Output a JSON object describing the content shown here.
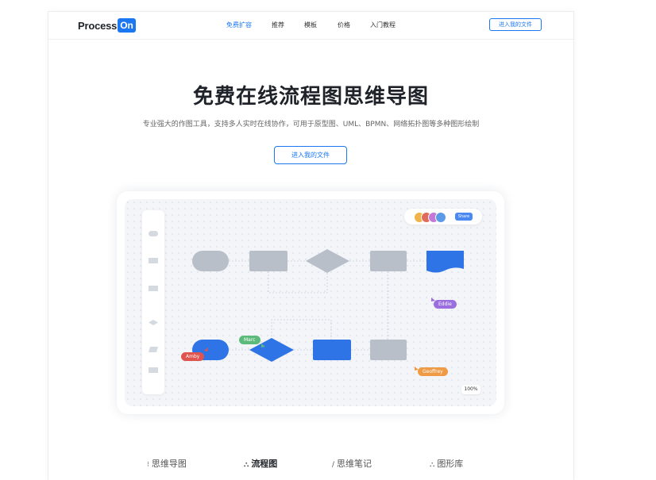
{
  "header": {
    "logo_text": "Process",
    "logo_badge": "On",
    "nav": [
      {
        "label": "免费扩容"
      },
      {
        "label": "推荐"
      },
      {
        "label": "模板"
      },
      {
        "label": "价格"
      },
      {
        "label": "入门教程"
      }
    ],
    "cta_label": "进入我的文件",
    "accent_color": "#1b77f2"
  },
  "hero": {
    "title": "免费在线流程图思维导图",
    "subtitle": "专业强大的作图工具，支持多人实时在线协作，可用于原型图、UML、BPMN、网络拓扑图等多种图形绘制",
    "cta_label": "进入我的文件"
  },
  "editor": {
    "share_label": "Share",
    "zoom_label": "100%",
    "collaborators": [
      {
        "name": "Eddie",
        "color": "#9b6ee0"
      },
      {
        "name": "Marc",
        "color": "#5cbb7a"
      },
      {
        "name": "Amby",
        "color": "#e0544f"
      },
      {
        "name": "Geoffrey",
        "color": "#ef9a45"
      }
    ]
  },
  "tabs": [
    {
      "icon": "mindmap-icon",
      "glyph": "⁝",
      "label": "思维导图"
    },
    {
      "icon": "flowchart-icon",
      "glyph": "⛬",
      "label": "流程图"
    },
    {
      "icon": "pen-icon",
      "glyph": "∕",
      "label": "思维笔记"
    },
    {
      "icon": "shapes-icon",
      "glyph": "⛬",
      "label": "图形库"
    }
  ]
}
